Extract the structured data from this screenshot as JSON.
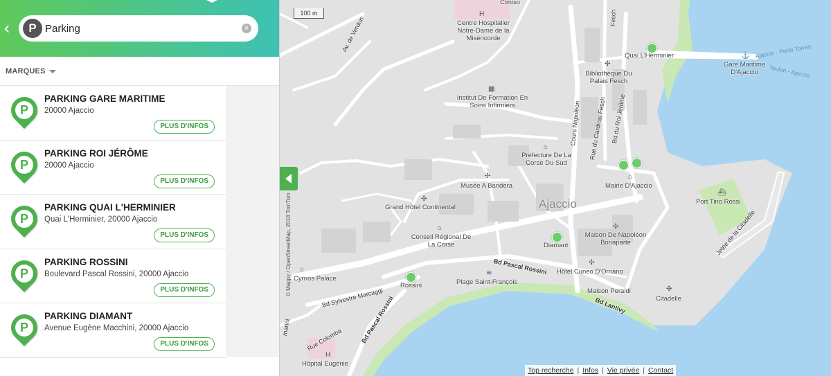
{
  "search": {
    "value": "Parking",
    "logo_letter": "P",
    "back_glyph": "‹",
    "clear_glyph": "×"
  },
  "filters": {
    "brands_label": "MARQUES"
  },
  "results": [
    {
      "title": "PARKING GARE MARITIME",
      "address": "20000 Ajaccio",
      "more_label": "PLUS D'INFOS"
    },
    {
      "title": "PARKING ROI JÉRÔME",
      "address": "20000 Ajaccio",
      "more_label": "PLUS D'INFOS"
    },
    {
      "title": "PARKING QUAI L'HERMINIER",
      "address": "Quai L'Herminier, 20000 Ajaccio",
      "more_label": "PLUS D'INFOS"
    },
    {
      "title": "PARKING ROSSINI",
      "address": "Boulevard Pascal Rossini, 20000 Ajaccio",
      "more_label": "PLUS D'INFOS"
    },
    {
      "title": "PARKING DIAMANT",
      "address": "Avenue Eugène Macchini, 20000 Ajaccio",
      "more_label": "PLUS D'INFOS"
    }
  ],
  "pin_letter": "P",
  "map": {
    "scale": "100 m",
    "city": "Ajaccio",
    "attribution": "© Mappy / OpenStreetMap, 2018 TomTom",
    "places": {
      "hospital": "Centre Hospitalier Notre-Dame de la Miséricorde",
      "hospital_top": "Cimiso",
      "institut": "Institut De Formation En Soins Infirmiers",
      "bibliotheque": "Bibliothèque Du Palais Fesch",
      "quai": "Quai L'Herminier",
      "gare": "Gare Maritime D'Ajaccio",
      "prefecture": "Préfecture De La Corse Du Sud",
      "musee": "Musée A Bandera",
      "mairie": "Mairie D'Ajaccio",
      "grand_hotel": "Grand Hôtel Continental",
      "conseil": "Conseil Régional De La Corse",
      "port": "Port Tino Rossi",
      "diamant": "Diamant",
      "maison": "Maison De Napoléon Bonaparte",
      "cyrnos": "Cyrnos Palace",
      "rossini": "Rossini",
      "plage": "Plage Saint-François",
      "cuneo": "Hôtel Cuneo D'Ornano",
      "peraldi": "Maison Peraldi",
      "citadelle": "Citadelle",
      "hopital": "Hôpital Eugénie"
    },
    "streets": {
      "verdun": "Av. de Verdun",
      "napoleon": "Cours Napoléon",
      "cardinal": "Rue du Cardinal Fesch",
      "roi": "Bd du Roi Jérôme",
      "fesch_top": "Fesch",
      "pascal": "Bd Pascal Rossini",
      "pascal2": "Bd Pascal Rossini",
      "sylvestre": "Bd Sylvestre Marcaggi",
      "colomba": "Rue Colomba",
      "lantivy": "Bd Lantivy",
      "jetee": "Jetée de la Citadelle",
      "macchini": "marini"
    },
    "sea": {
      "route1": "Ajaccio - Porto Torres",
      "route2": "Toulon - Ajaccio"
    }
  },
  "footer": {
    "links": [
      "Top recherche",
      "Infos",
      "Vie privée",
      "Contact"
    ],
    "separator": "|"
  },
  "colors": {
    "accent": "#4db14f",
    "gradient_start": "#5fc95a",
    "gradient_end": "#3ec1b5",
    "sea": "#a8d4f2",
    "land": "#e2e2e2",
    "park": "#c9e8b4"
  }
}
